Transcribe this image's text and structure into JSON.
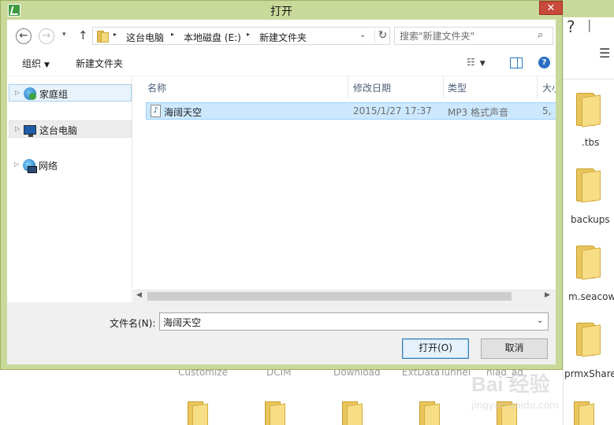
{
  "dialog": {
    "title": "打开",
    "close_glyph": "✕"
  },
  "nav_buttons": {
    "back_glyph": "←",
    "forward_glyph": "→",
    "recent_glyph": "▾",
    "up_glyph": "↑"
  },
  "address_bar": {
    "breadcrumbs": [
      "这台电脑",
      "本地磁盘 (E:)",
      "新建文件夹"
    ],
    "separator_glyph": "▸",
    "dropdown_glyph": "⌄",
    "refresh_glyph": "↻"
  },
  "search": {
    "placeholder": "搜索\"新建文件夹\"",
    "icon_glyph": "⌕"
  },
  "toolbar": {
    "organize_label": "组织",
    "caret_glyph": "▼",
    "new_folder_label": "新建文件夹",
    "view_glyph": "☷",
    "help_glyph": "?"
  },
  "nav_pane": {
    "expander_glyph": "▷",
    "items": [
      {
        "label": "家庭组",
        "icon": "homegroup-icon",
        "state": "selected"
      },
      {
        "label": "这台电脑",
        "icon": "this-pc-icon",
        "state": "hover"
      },
      {
        "label": "网络",
        "icon": "network-icon",
        "state": "normal"
      }
    ]
  },
  "file_list": {
    "sort_glyph": "˄",
    "columns": [
      "名称",
      "修改日期",
      "类型",
      "大小"
    ],
    "rows": [
      {
        "name": "海阔天空",
        "modified": "2015/1/27 17:37",
        "type": "MP3 格式声音",
        "size": "5,",
        "icon": "mp3-file-icon"
      }
    ]
  },
  "scrollbar": {
    "left_glyph": "◀",
    "right_glyph": "▶"
  },
  "bottom": {
    "filename_label": "文件名(N):",
    "filename_value": "海阔天空",
    "dropdown_glyph": "⌄",
    "open_label": "打开(O)",
    "cancel_label": "取消"
  },
  "background": {
    "help_glyph": "?",
    "menu_glyph": "☰",
    "folders": [
      ".tbs",
      "backups",
      "m.seacow",
      "prmxShare"
    ],
    "bottom_labels": [
      "Customize",
      "DCIM",
      "Download",
      "ExtDataTunnel",
      "hiad_ad"
    ]
  },
  "watermark": {
    "main": "Bai 经验",
    "sub": "jingyan.baidu.com"
  },
  "colors": {
    "title_bar": "#c9d99a",
    "selection": "#cce8ff",
    "close_button": "#c74a3a",
    "header_text": "#4c607a",
    "folder": "#f7dd86"
  }
}
